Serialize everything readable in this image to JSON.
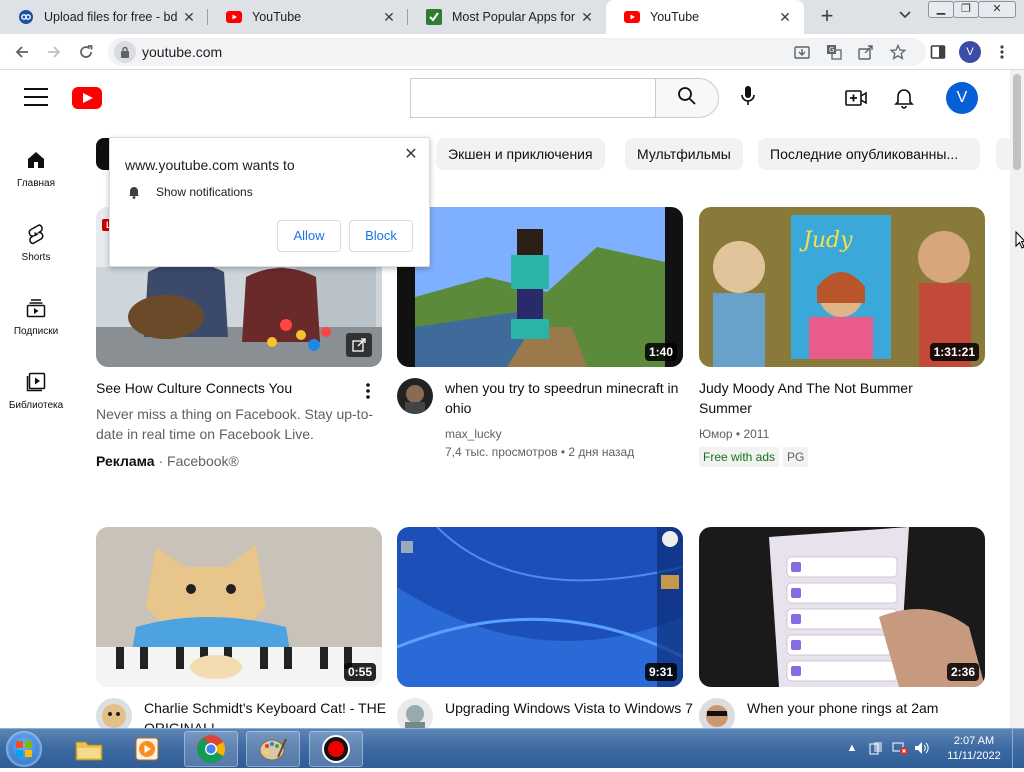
{
  "browser": {
    "tabs": [
      {
        "title": "Upload files for free - bdc",
        "icon": "cloud-icon"
      },
      {
        "title": "YouTube",
        "icon": "youtube-icon"
      },
      {
        "title": "Most Popular Apps for W",
        "icon": "apps-icon"
      },
      {
        "title": "YouTube",
        "icon": "youtube-icon",
        "active": true
      }
    ],
    "url": "youtube.com",
    "profile_initial": "V"
  },
  "popup": {
    "title": "www.youtube.com wants to",
    "permission": "Show notifications",
    "allow_label": "Allow",
    "block_label": "Block"
  },
  "sidebar": {
    "items": [
      {
        "label": "Главная",
        "icon": "home-icon"
      },
      {
        "label": "Shorts",
        "icon": "shorts-icon"
      },
      {
        "label": "Подписки",
        "icon": "subscriptions-icon"
      },
      {
        "label": "Библиотека",
        "icon": "library-icon"
      }
    ]
  },
  "header": {
    "avatar_initial": "V"
  },
  "chips": [
    "Экшен и приключения",
    "Мультфильмы",
    "Последние опубликованны..."
  ],
  "videos": [
    {
      "title": "See How Culture Connects You",
      "description": "Never miss a thing on Facebook. Stay up-to-date in real time on Facebook Live.",
      "ad_label": "Реклама",
      "advertiser": "Facebook®",
      "live_badge": "LIVE"
    },
    {
      "title": "when you try to speedrun minecraft in ohio",
      "channel": "max_lucky",
      "stats": "7,4 тыс. просмотров • 2 дня назад",
      "duration": "1:40"
    },
    {
      "title": "Judy Moody And The Not Bummer Summer",
      "channel": "Юмор • 2011",
      "badge_free": "Free with ads",
      "badge_rating": "PG",
      "duration": "1:31:21"
    },
    {
      "title": "Charlie Schmidt's Keyboard Cat! - THE ORIGINAL!",
      "duration": "0:55"
    },
    {
      "title": "Upgrading Windows Vista to Windows 7",
      "duration": "9:31"
    },
    {
      "title": "When your phone rings at 2am",
      "duration": "2:36"
    }
  ],
  "taskbar": {
    "time": "2:07 AM",
    "date": "11/11/2022"
  },
  "colors": {
    "youtube_red": "#ff0000",
    "chrome_blue": "#1a73e8",
    "free_green": "#107516",
    "avatar_blue": "#065fd4"
  }
}
